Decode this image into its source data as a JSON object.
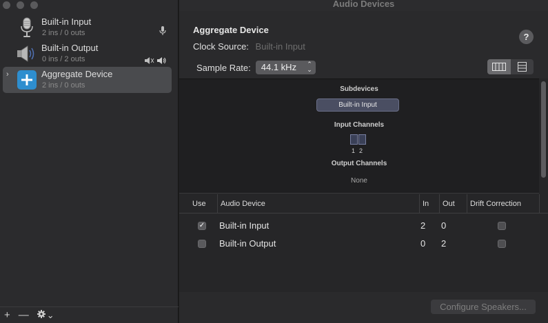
{
  "sidebar": {
    "devices": [
      {
        "name": "Built-in Input",
        "io": "2 ins / 0 outs",
        "icon": "microphone-icon"
      },
      {
        "name": "Built-in Output",
        "io": "0 ins / 2 outs",
        "icon": "speaker-icon"
      },
      {
        "name": "Aggregate Device",
        "io": "2 ins / 0 outs",
        "icon": "aggregate-plus-icon",
        "selected": true
      }
    ],
    "bottom": {
      "add": "+",
      "remove": "—",
      "gear_chevron": "⌄"
    }
  },
  "window": {
    "title": "Audio Devices"
  },
  "device": {
    "title": "Aggregate Device",
    "clock_source_label": "Clock Source:",
    "clock_source_value": "Built-in Input",
    "sample_rate_label": "Sample Rate:",
    "sample_rate_value": "44.1 kHz",
    "help": "?"
  },
  "subpanel": {
    "subdevices_label": "Subdevices",
    "subdevice_chip": "Built-in Input",
    "input_channels_label": "Input Channels",
    "channel_numbers": [
      "1",
      "2"
    ],
    "output_channels_label": "Output Channels",
    "output_none": "None"
  },
  "table": {
    "headers": {
      "use": "Use",
      "device": "Audio Device",
      "in": "In",
      "out": "Out",
      "drift": "Drift Correction"
    },
    "rows": [
      {
        "use": true,
        "device": "Built-in Input",
        "in": "2",
        "out": "0",
        "drift": false
      },
      {
        "use": false,
        "device": "Built-in Output",
        "in": "0",
        "out": "2",
        "drift": false
      }
    ]
  },
  "footer": {
    "configure_speakers": "Configure Speakers..."
  }
}
